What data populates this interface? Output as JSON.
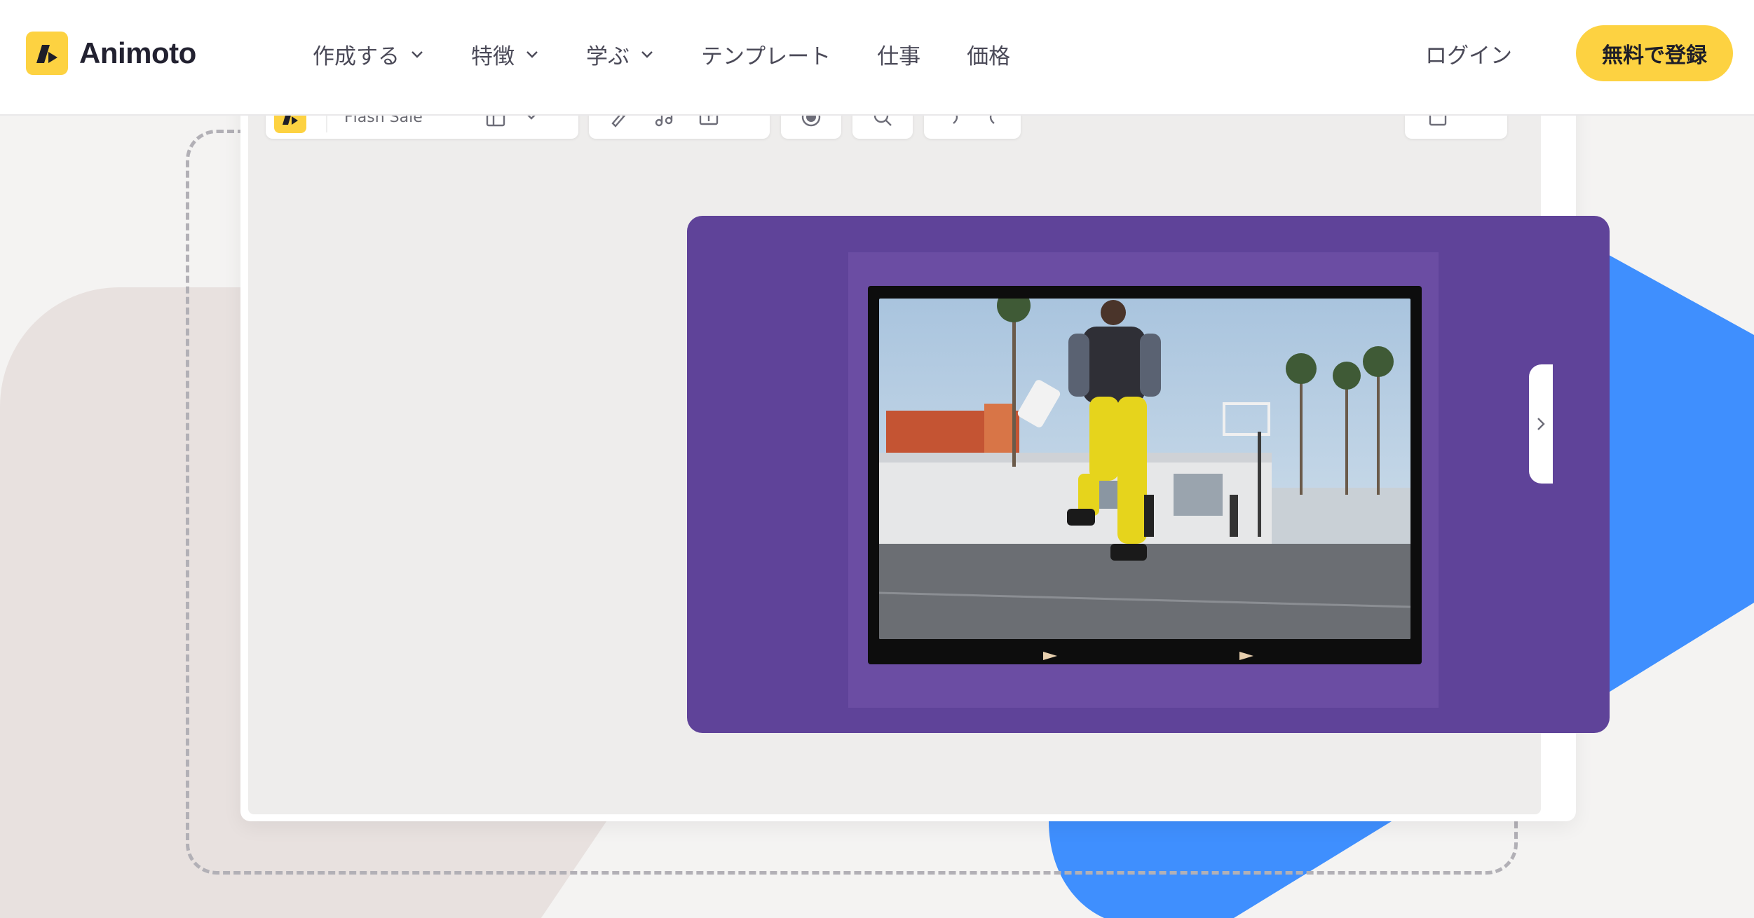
{
  "brand": {
    "name": "Animoto",
    "accent": "#fdd241"
  },
  "nav": {
    "items": [
      {
        "label": "作成する",
        "has_dropdown": true
      },
      {
        "label": "特徴",
        "has_dropdown": true
      },
      {
        "label": "学ぶ",
        "has_dropdown": true
      },
      {
        "label": "テンプレート",
        "has_dropdown": false
      },
      {
        "label": "仕事",
        "has_dropdown": false
      },
      {
        "label": "価格",
        "has_dropdown": false
      }
    ],
    "login_label": "ログイン",
    "signup_label": "無料で登録"
  },
  "editor_preview": {
    "project_name": "Flash Sale",
    "toolbar_icons": [
      "layout-icon",
      "chevron-down-icon",
      "brush-icon",
      "music-icon",
      "text-icon",
      "record-icon",
      "zoom-icon",
      "undo-icon",
      "redo-icon",
      "save-icon"
    ],
    "video_background_color": "#5f4399",
    "panel_toggle_icon": "chevron-right-icon"
  },
  "colors": {
    "background": "#f4f3f2",
    "blue_shape": "#3f8ffe",
    "beige_shape": "#e8e1df",
    "dashed_border": "#b2b0b6"
  }
}
